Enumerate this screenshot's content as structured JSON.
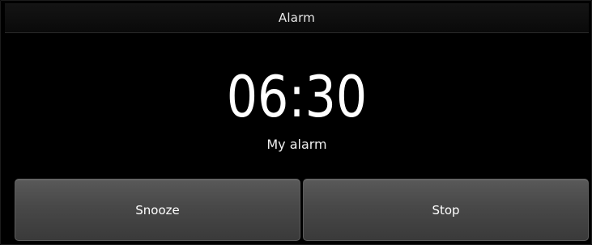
{
  "header": {
    "title": "Alarm"
  },
  "alarm": {
    "time": "06:30",
    "label": "My alarm"
  },
  "actions": {
    "snooze_label": "Snooze",
    "stop_label": "Stop"
  },
  "colors": {
    "background": "#000000",
    "button": "#4a4a4a",
    "text": "#ffffff"
  }
}
